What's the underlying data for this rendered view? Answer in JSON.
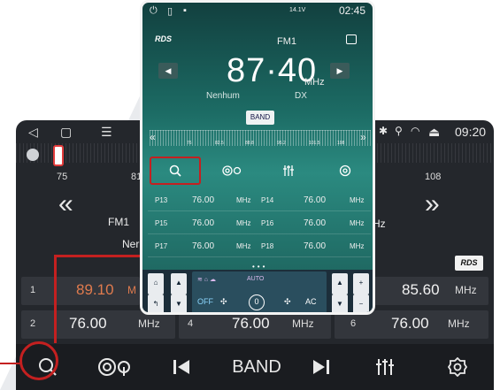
{
  "tablet": {
    "status": {
      "time": "09:20"
    },
    "scale": {
      "left_num": "75",
      "mid_num": "81",
      "right_num": "108"
    },
    "band": "FM1",
    "station_partial": "Ner",
    "mhz_partial": "Hz",
    "rds": "RDS",
    "presets_row1": [
      {
        "num": "1",
        "freq": "89.10",
        "unit": "M",
        "active": true
      },
      {
        "num": "",
        "freq": "85.60",
        "unit": "MHz"
      }
    ],
    "presets_row2": [
      {
        "num": "2",
        "freq": "76.00",
        "unit": "MHz"
      },
      {
        "num": "4",
        "freq": "76.00",
        "unit": "MHz"
      },
      {
        "num": "6",
        "freq": "76.00",
        "unit": "MHz"
      }
    ],
    "bottom_bar": {
      "band_label": "BAND"
    }
  },
  "phone": {
    "status": {
      "battery": "14.1V",
      "time": "02:45"
    },
    "rds": "RDS",
    "band": "FM1",
    "frequency": "87·40",
    "unit": "MHz",
    "station": "Nenhum",
    "mode": "DX",
    "band_button": "BAND",
    "scale_ticks": [
      "76",
      "82.5",
      "88.8",
      "95.2",
      "101.5",
      "108"
    ],
    "presets": [
      [
        {
          "p": "P13",
          "f": "76.00",
          "u": "MHz"
        },
        {
          "p": "P14",
          "f": "76.00",
          "u": "MHz"
        }
      ],
      [
        {
          "p": "P15",
          "f": "76.00",
          "u": "MHz"
        },
        {
          "p": "P16",
          "f": "76.00",
          "u": "MHz"
        }
      ],
      [
        {
          "p": "P17",
          "f": "76.00",
          "u": "MHz"
        },
        {
          "p": "P18",
          "f": "76.00",
          "u": "MHz"
        }
      ]
    ],
    "climate": {
      "auto": "AUTO",
      "off": "OFF",
      "fan": "0",
      "ac": "AC"
    }
  }
}
